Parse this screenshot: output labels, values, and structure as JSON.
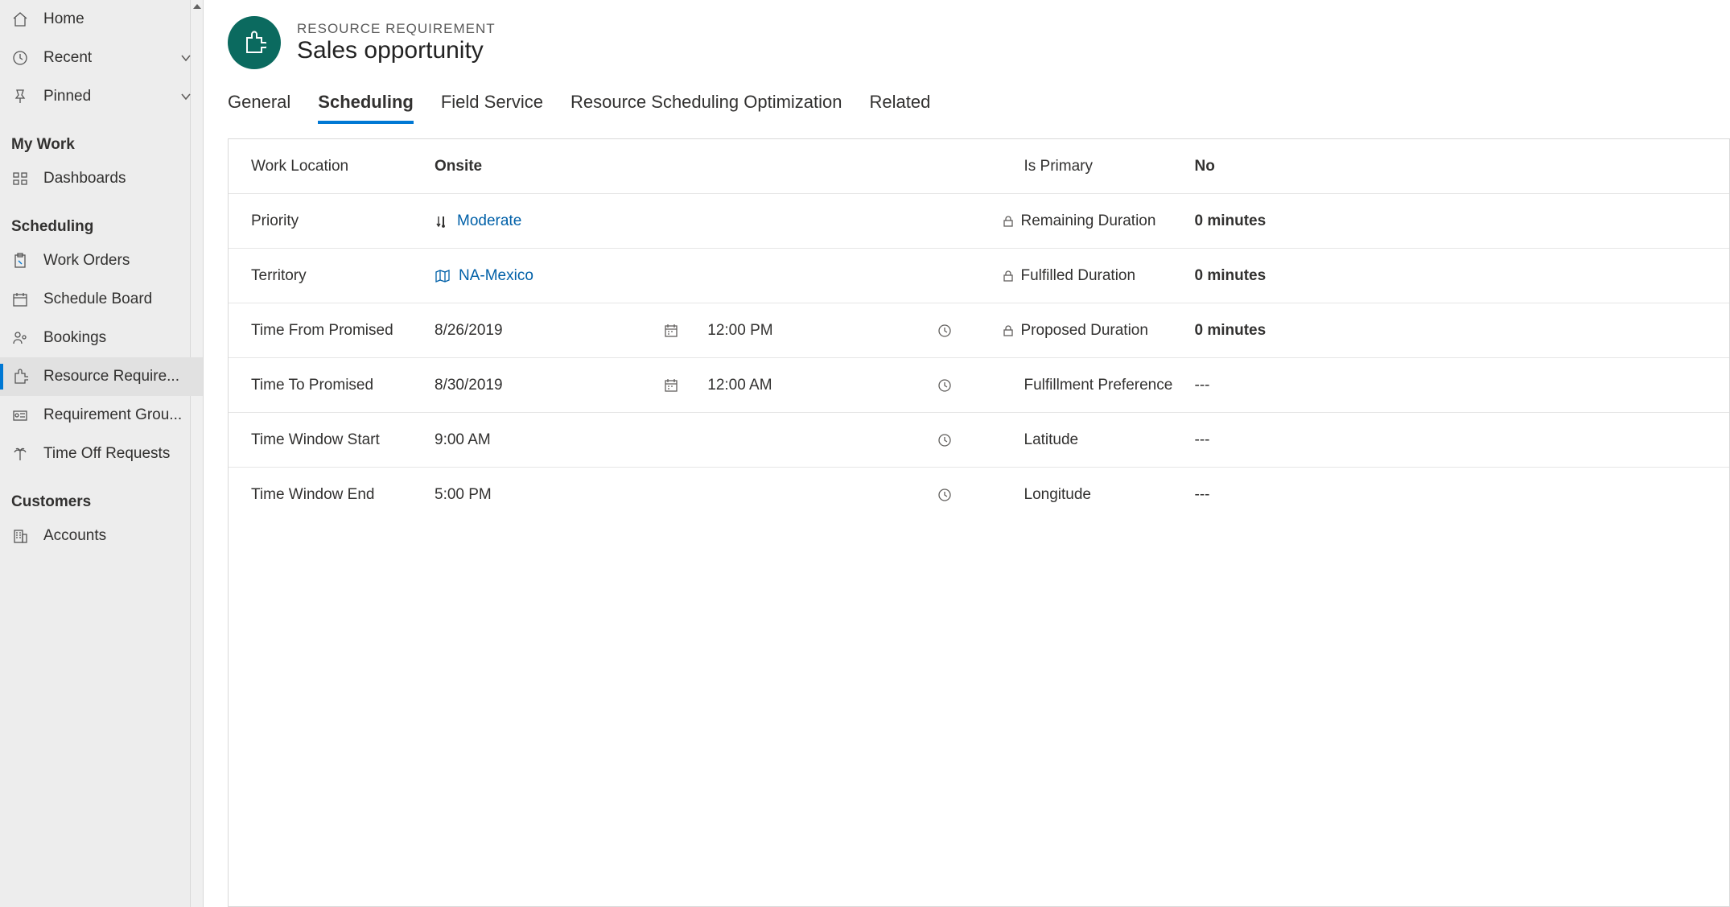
{
  "sidebar": {
    "top": [
      {
        "label": "Home"
      },
      {
        "label": "Recent"
      },
      {
        "label": "Pinned"
      }
    ],
    "groups": [
      {
        "title": "My Work",
        "items": [
          {
            "label": "Dashboards"
          }
        ]
      },
      {
        "title": "Scheduling",
        "items": [
          {
            "label": "Work Orders"
          },
          {
            "label": "Schedule Board"
          },
          {
            "label": "Bookings"
          },
          {
            "label": "Resource Require..."
          },
          {
            "label": "Requirement Grou..."
          },
          {
            "label": "Time Off Requests"
          }
        ]
      },
      {
        "title": "Customers",
        "items": [
          {
            "label": "Accounts"
          }
        ]
      }
    ]
  },
  "header": {
    "subtitle": "RESOURCE REQUIREMENT",
    "title": "Sales opportunity"
  },
  "tabs": [
    {
      "label": "General"
    },
    {
      "label": "Scheduling"
    },
    {
      "label": "Field Service"
    },
    {
      "label": "Resource Scheduling Optimization"
    },
    {
      "label": "Related"
    }
  ],
  "form": {
    "left": {
      "work_location_label": "Work Location",
      "work_location_value": "Onsite",
      "priority_label": "Priority",
      "priority_value": "Moderate",
      "territory_label": "Territory",
      "territory_value": "NA-Mexico",
      "time_from_label": "Time From Promised",
      "time_from_date": "8/26/2019",
      "time_from_time": "12:00 PM",
      "time_to_label": "Time To Promised",
      "time_to_date": "8/30/2019",
      "time_to_time": "12:00 AM",
      "time_window_start_label": "Time Window Start",
      "time_window_start_value": "9:00 AM",
      "time_window_end_label": "Time Window End",
      "time_window_end_value": "5:00 PM"
    },
    "right": {
      "is_primary_label": "Is Primary",
      "is_primary_value": "No",
      "remaining_duration_label": "Remaining Duration",
      "remaining_duration_value": "0 minutes",
      "fulfilled_duration_label": "Fulfilled Duration",
      "fulfilled_duration_value": "0 minutes",
      "proposed_duration_label": "Proposed Duration",
      "proposed_duration_value": "0 minutes",
      "fulfillment_pref_label": "Fulfillment Preference",
      "fulfillment_pref_value": "---",
      "latitude_label": "Latitude",
      "latitude_value": "---",
      "longitude_label": "Longitude",
      "longitude_value": "---"
    }
  }
}
